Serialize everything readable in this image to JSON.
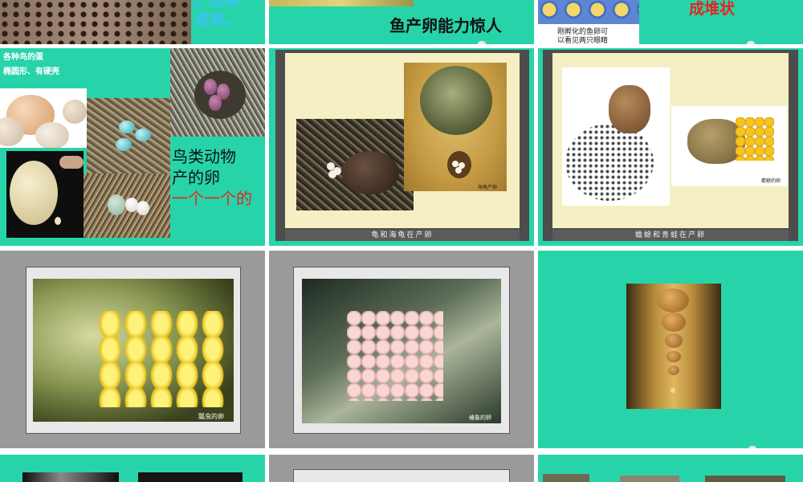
{
  "row1": {
    "s1_text": "成串。",
    "s1_text_top": "。成串",
    "s2_text": "鱼产卵能力惊人",
    "s3_caption_line1": "刚孵化的鱼卵可",
    "s3_caption_line2": "以看见两只眼睛",
    "s3_text": "成堆状"
  },
  "birds": {
    "title": "各种鸟的蛋",
    "subtitle": "椭圆形、有硬壳",
    "line1": "鸟类动物",
    "line2": "产的卵",
    "line3": "一个一个的"
  },
  "turtle": {
    "inner_label": "海龟产卵",
    "caption": "龟和海龟在产卵"
  },
  "frog": {
    "inner_label": "蟾蜍的卵",
    "caption": "蟾蜍和青蛙在产卵"
  },
  "insect": {
    "label": "瓢虫的卵"
  },
  "stinkbug": {
    "label": "椿象的卵"
  },
  "colors": {
    "teal": "#27d4a9",
    "gray": "#9a9a9a",
    "red": "#e8231e"
  }
}
